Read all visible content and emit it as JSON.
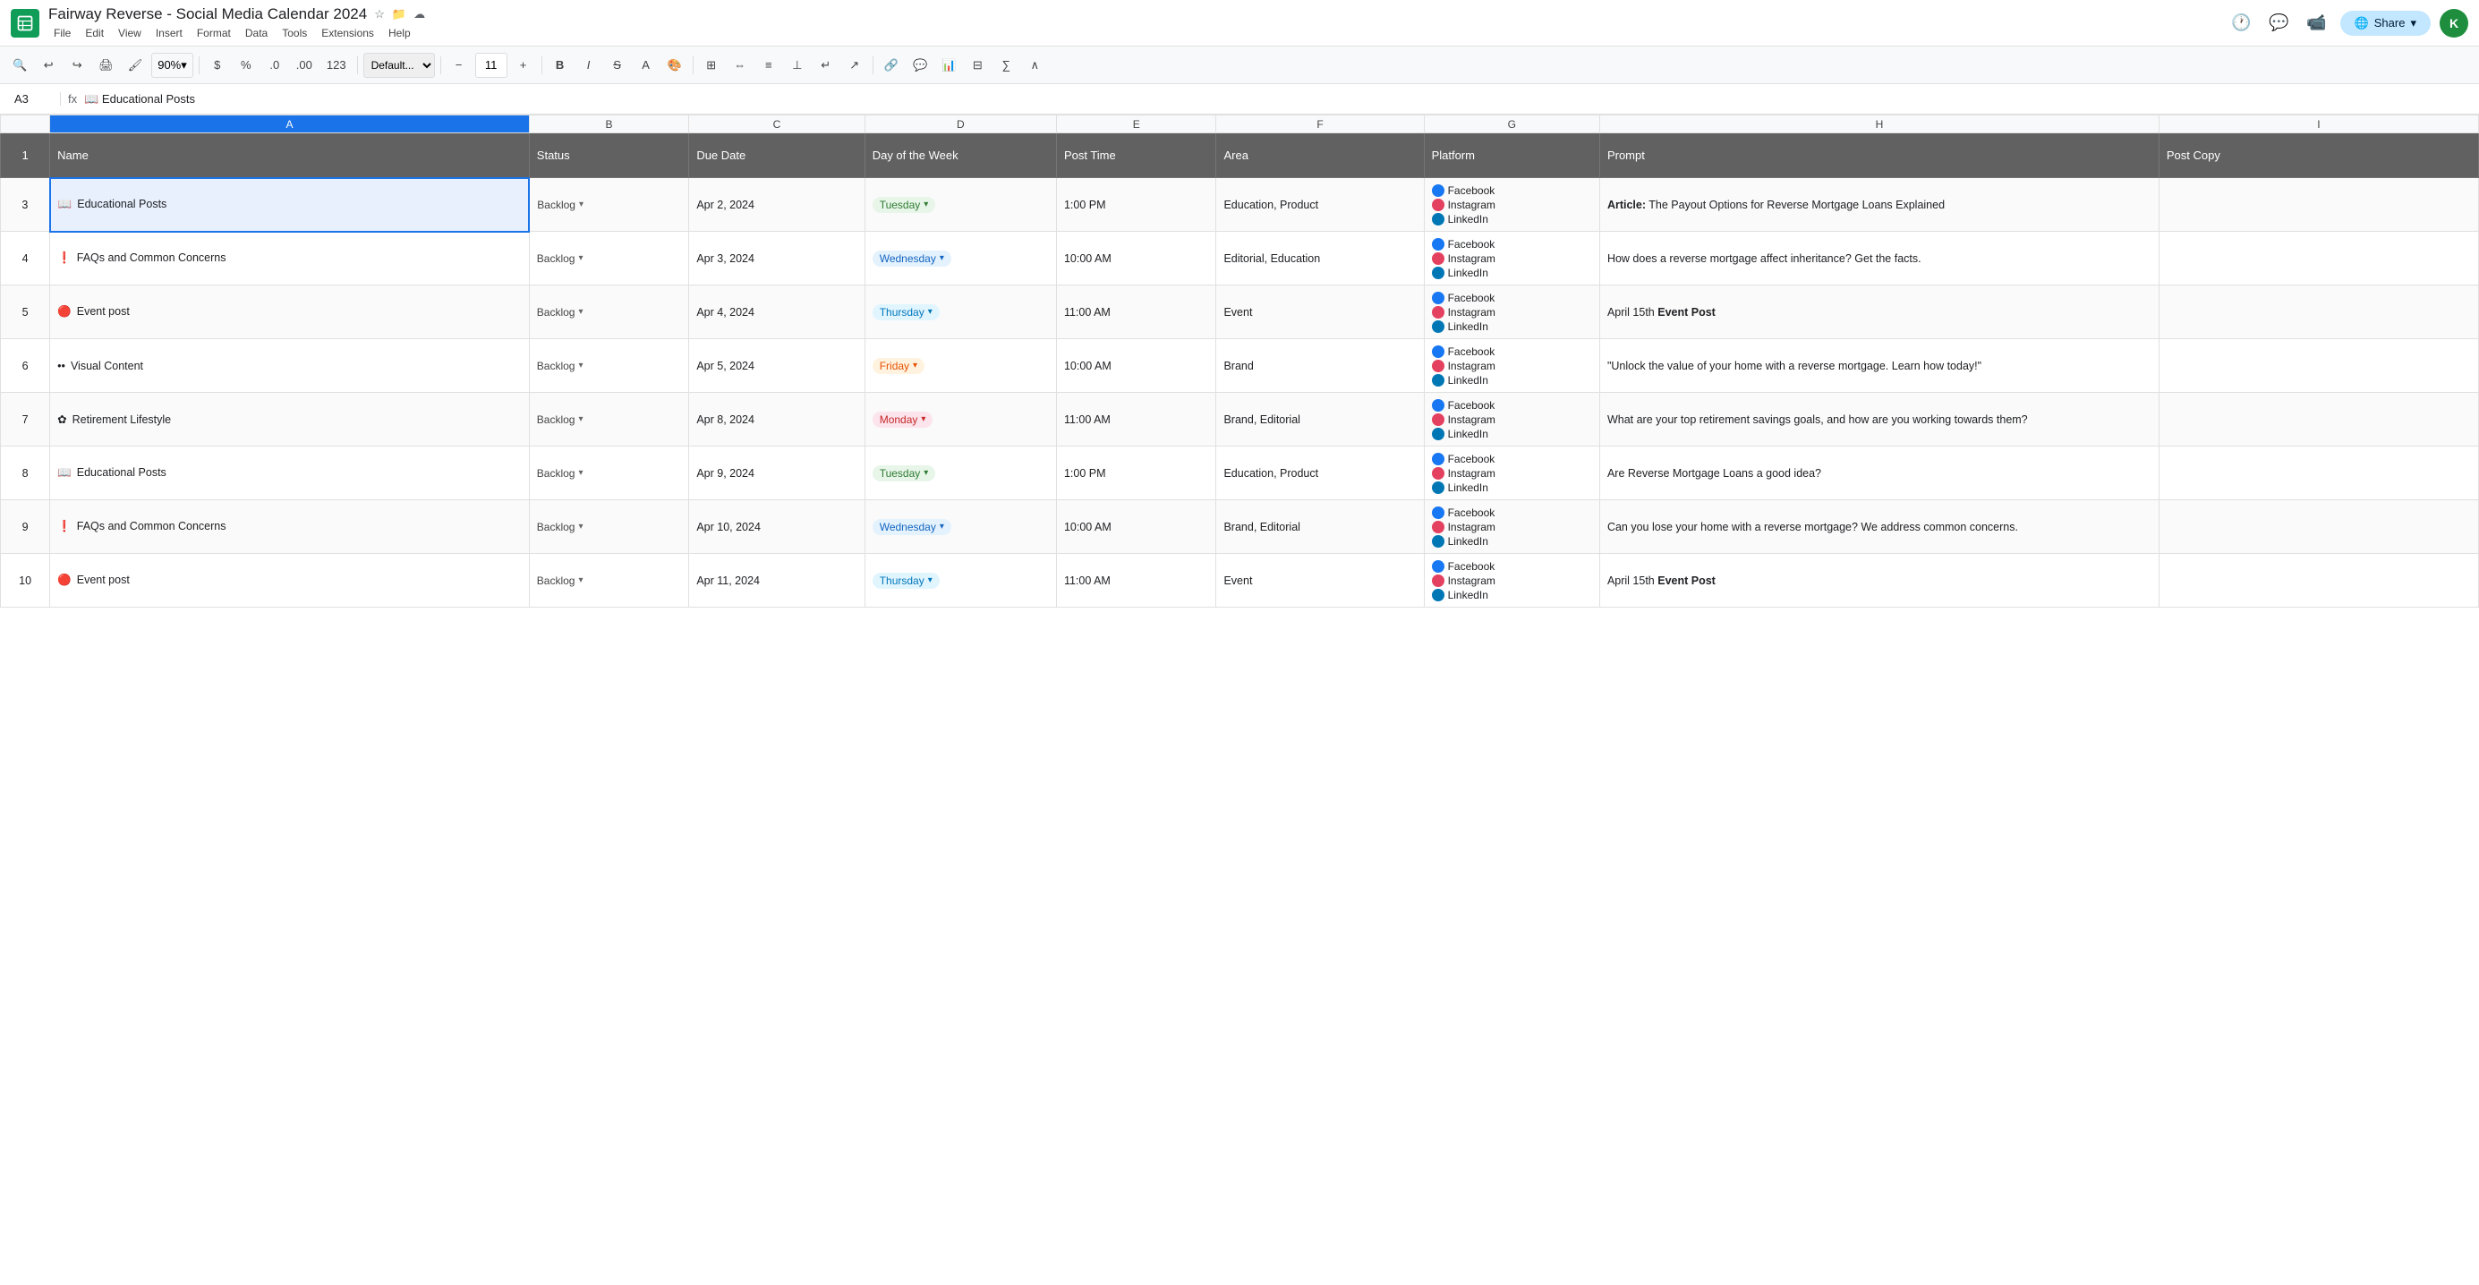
{
  "app": {
    "icon": "G",
    "title": "Fairway Reverse - Social Media Calendar 2024",
    "menus": [
      "File",
      "Edit",
      "View",
      "Insert",
      "Format",
      "Data",
      "Tools",
      "Extensions",
      "Help"
    ]
  },
  "toolbar": {
    "zoom": "90%",
    "currency": "$",
    "percent": "%",
    "decimal_dec": ".0",
    "decimal_inc": ".00",
    "number_format": "123",
    "font": "Default...",
    "font_size": "11"
  },
  "formula_bar": {
    "cell_ref": "A3",
    "formula_label": "fx",
    "content": "📖 Educational Posts"
  },
  "share_btn": "Share",
  "user_initial": "K",
  "columns": {
    "row_num": "",
    "A": "A",
    "B": "B",
    "C": "C",
    "D": "D",
    "E": "E",
    "F": "F",
    "G": "G",
    "H": "H"
  },
  "header_row": {
    "name": "Name",
    "status": "Status",
    "due_date": "Due Date",
    "day_of_week": "Day of the Week",
    "post_time": "Post Time",
    "area": "Area",
    "platform": "Platform",
    "prompt": "Prompt",
    "post_copy": "Post Copy"
  },
  "rows": [
    {
      "row_num": "3",
      "name": "Educational Posts",
      "name_icon": "📖",
      "name_icon_type": "edu",
      "status": "Backlog",
      "due_date": "Apr 2, 2024",
      "day": "Tuesday",
      "day_class": "day-tuesday",
      "post_time": "1:00 PM",
      "area": "Education, Product",
      "platforms": [
        "Facebook",
        "Instagram",
        "LinkedIn"
      ],
      "prompt": "Article: The Payout Options for Reverse Mortgage Loans Explained",
      "prompt_bold_prefix": "Article:",
      "post_copy": ""
    },
    {
      "row_num": "4",
      "name": "FAQs and Common Concerns",
      "name_icon": "❗",
      "name_icon_type": "faq",
      "status": "Backlog",
      "due_date": "Apr 3, 2024",
      "day": "Wednesday",
      "day_class": "day-wednesday",
      "post_time": "10:00 AM",
      "area": "Editorial, Education",
      "platforms": [
        "Facebook",
        "Instagram",
        "LinkedIn"
      ],
      "prompt": "How does a reverse mortgage affect inheritance? Get the facts.",
      "prompt_bold_prefix": "",
      "post_copy": ""
    },
    {
      "row_num": "5",
      "name": "Event post",
      "name_icon": "🔴",
      "name_icon_type": "event",
      "status": "Backlog",
      "due_date": "Apr 4, 2024",
      "day": "Thursday",
      "day_class": "day-thursday",
      "post_time": "11:00 AM",
      "area": "Event",
      "platforms": [
        "Facebook",
        "Instagram",
        "LinkedIn"
      ],
      "prompt": "April 15th Event Post",
      "prompt_bold_text": "Event Post",
      "prompt_bold_prefix": "April 15th",
      "post_copy": ""
    },
    {
      "row_num": "6",
      "name": "Visual Content",
      "name_icon": "••",
      "name_icon_type": "visual",
      "status": "Backlog",
      "due_date": "Apr 5, 2024",
      "day": "Friday",
      "day_class": "day-friday",
      "post_time": "10:00 AM",
      "area": "Brand",
      "platforms": [
        "Facebook",
        "Instagram",
        "LinkedIn"
      ],
      "prompt": "\"Unlock the value of your home with a reverse mortgage. Learn how today!\"",
      "prompt_bold_prefix": "",
      "post_copy": ""
    },
    {
      "row_num": "7",
      "name": "Retirement Lifestyle",
      "name_icon": "✿",
      "name_icon_type": "retire",
      "status": "Backlog",
      "due_date": "Apr 8, 2024",
      "day": "Monday",
      "day_class": "day-monday",
      "post_time": "11:00 AM",
      "area": "Brand, Editorial",
      "platforms": [
        "Facebook",
        "Instagram",
        "LinkedIn"
      ],
      "prompt": "What are your top retirement savings goals, and how are you working towards them?",
      "prompt_bold_prefix": "",
      "post_copy": ""
    },
    {
      "row_num": "8",
      "name": "Educational Posts",
      "name_icon": "📖",
      "name_icon_type": "edu",
      "status": "Backlog",
      "due_date": "Apr 9, 2024",
      "day": "Tuesday",
      "day_class": "day-tuesday",
      "post_time": "1:00 PM",
      "area": "Education, Product",
      "platforms": [
        "Facebook",
        "Instagram",
        "LinkedIn"
      ],
      "prompt": "Are Reverse Mortgage Loans a good idea?",
      "prompt_bold_prefix": "",
      "post_copy": ""
    },
    {
      "row_num": "9",
      "name": "FAQs and Common Concerns",
      "name_icon": "❗",
      "name_icon_type": "faq",
      "status": "Backlog",
      "due_date": "Apr 10, 2024",
      "day": "Wednesday",
      "day_class": "day-wednesday",
      "post_time": "10:00 AM",
      "area": "Brand, Editorial",
      "platforms": [
        "Facebook",
        "Instagram",
        "LinkedIn"
      ],
      "prompt": "Can you lose your home with a reverse mortgage? We address common concerns.",
      "prompt_bold_prefix": "",
      "post_copy": ""
    },
    {
      "row_num": "10",
      "name": "Event post",
      "name_icon": "🔴",
      "name_icon_type": "event",
      "status": "Backlog",
      "due_date": "Apr 11, 2024",
      "day": "Thursday",
      "day_class": "day-thursday",
      "post_time": "11:00 AM",
      "area": "Event",
      "platforms": [
        "Facebook",
        "Instagram",
        "LinkedIn"
      ],
      "prompt": "April 15th Event Post",
      "prompt_bold_text": "Event Post",
      "prompt_bold_prefix": "April 15th",
      "post_copy": ""
    }
  ]
}
